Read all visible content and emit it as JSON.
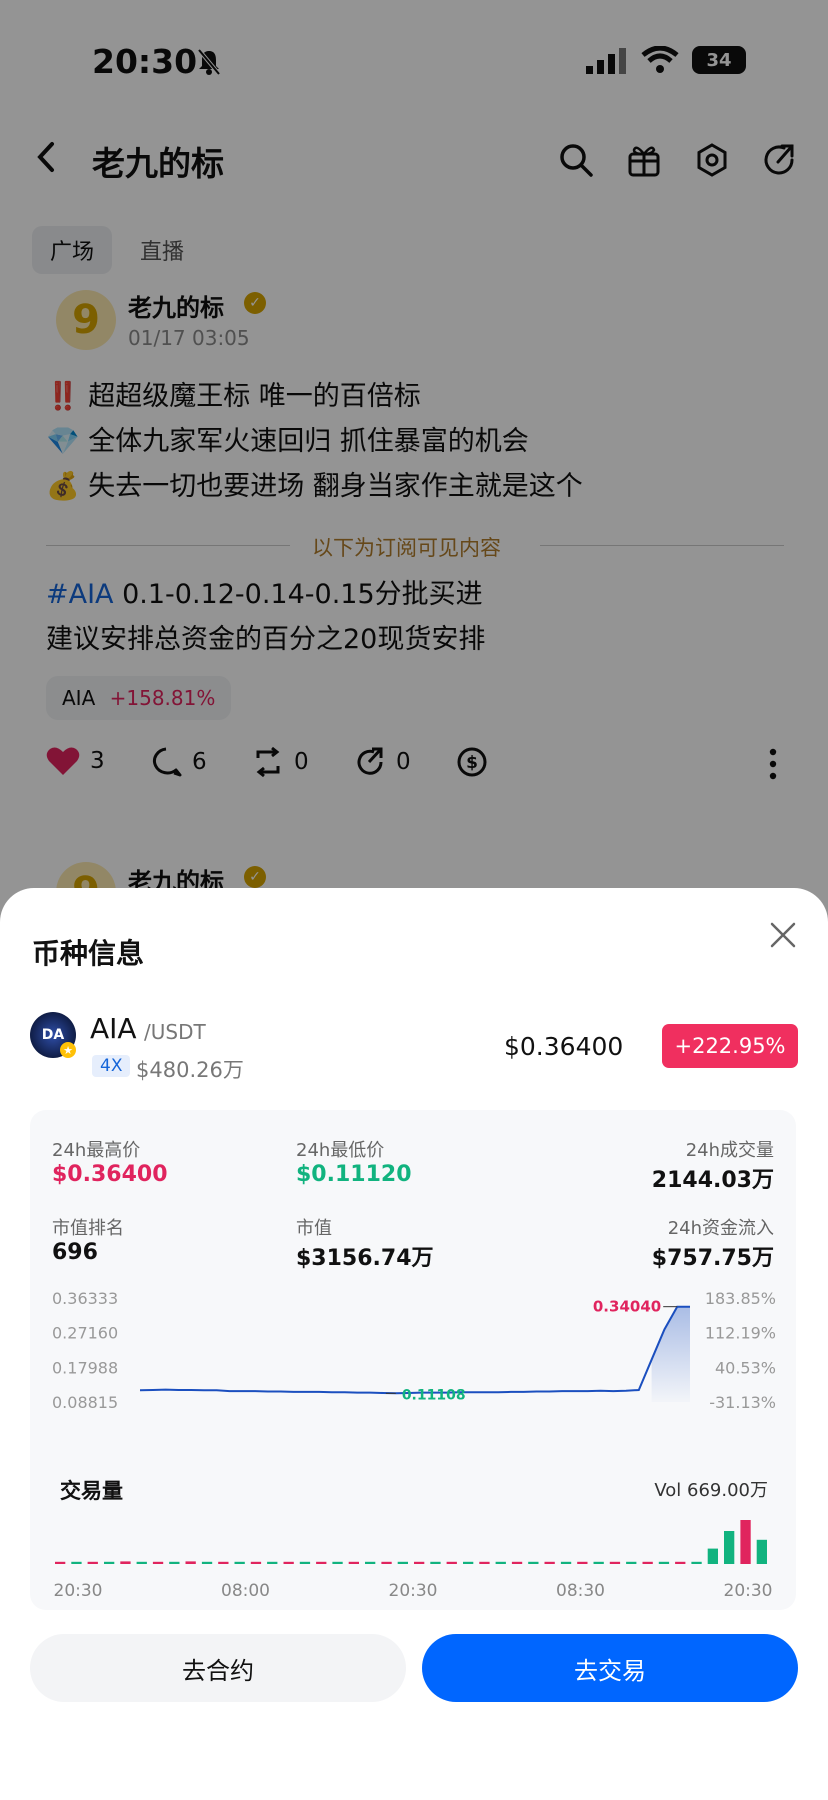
{
  "status_bar": {
    "time": "20:30",
    "battery": "34"
  },
  "header": {
    "title": "老九的标"
  },
  "tabs": [
    {
      "label": "广场"
    },
    {
      "label": "直播"
    }
  ],
  "post": {
    "author": "老九的标",
    "avatar_text": "9",
    "date": "01/17 03:05",
    "lines": [
      {
        "emoji": "‼️",
        "text": "超超级魔王标 唯一的百倍标"
      },
      {
        "emoji": "💎",
        "text": "全体九家军火速回归 抓住暴富的机会"
      },
      {
        "emoji": "💰",
        "text": "失去一切也要进场 翻身当家作主就是这个"
      }
    ],
    "divider_text": "以下为订阅可见内容",
    "hashtag": "#AIA",
    "body1": " 0.1-0.12-0.14-0.15分批买进",
    "body2": "建议安排总资金的百分之20现货安排",
    "token_pill": {
      "symbol": "AIA",
      "change": "+158.81%"
    },
    "actions": {
      "likes": "3",
      "comments": "6",
      "reposts": "0",
      "shares": "0"
    }
  },
  "post2": {
    "author": "老九的标"
  },
  "sheet": {
    "title": "币种信息",
    "coin": {
      "avatar_text": "DA",
      "symbol": "AIA",
      "pair": "/USDT",
      "leverage": "4X",
      "market_cap_small": "$480.26万",
      "price": "$0.36400",
      "change": "+222.95%"
    },
    "stats": [
      {
        "label": "24h最高价",
        "value": "$0.36400",
        "color": "#e0245e"
      },
      {
        "label": "24h最低价",
        "value": "$0.11120",
        "color": "#11b37f"
      },
      {
        "label": "24h成交量",
        "value": "2144.03万",
        "color": "#111111"
      },
      {
        "label": "市值排名",
        "value": "696",
        "color": "#111111"
      },
      {
        "label": "市值",
        "value": "$3156.74万",
        "color": "#111111"
      },
      {
        "label": "24h资金流入",
        "value": "$757.75万",
        "color": "#111111"
      }
    ],
    "volume_label": "交易量",
    "vol_text": "Vol 669.00万",
    "buttons": {
      "contract": "去合约",
      "trade": "去交易"
    }
  },
  "chart_data": {
    "type": "line",
    "y_left_ticks": [
      "0.36333",
      "0.27160",
      "0.17988",
      "0.08815"
    ],
    "y_right_ticks": [
      "183.85%",
      "112.19%",
      "40.53%",
      "-31.13%"
    ],
    "x_ticks": [
      "20:30",
      "08:00",
      "20:30",
      "08:30",
      "20:30"
    ],
    "ylim": [
      0.08815,
      0.36333
    ],
    "annotations": {
      "high": "0.34040",
      "low": "0.11108"
    },
    "series": [
      {
        "values": [
          0.119,
          0.12,
          0.121,
          0.12,
          0.12,
          0.119,
          0.119,
          0.117,
          0.117,
          0.117,
          0.116,
          0.116,
          0.115,
          0.115,
          0.115,
          0.114,
          0.114,
          0.113,
          0.113,
          0.112,
          0.1111,
          0.112,
          0.113,
          0.113,
          0.113,
          0.114,
          0.114,
          0.114,
          0.114,
          0.115,
          0.115,
          0.116,
          0.116,
          0.117,
          0.117,
          0.117,
          0.118,
          0.117,
          0.118,
          0.12,
          0.2,
          0.28,
          0.3404,
          0.3404
        ]
      }
    ],
    "volume": {
      "bars": [
        {
          "v": 0.05,
          "c": "#e0245e"
        },
        {
          "v": 0.05,
          "c": "#11b37f"
        },
        {
          "v": 0.05,
          "c": "#e0245e"
        },
        {
          "v": 0.05,
          "c": "#11b37f"
        },
        {
          "v": 0.06,
          "c": "#e0245e"
        },
        {
          "v": 0.05,
          "c": "#11b37f"
        },
        {
          "v": 0.05,
          "c": "#e0245e"
        },
        {
          "v": 0.05,
          "c": "#11b37f"
        },
        {
          "v": 0.06,
          "c": "#e0245e"
        },
        {
          "v": 0.05,
          "c": "#11b37f"
        },
        {
          "v": 0.05,
          "c": "#e0245e"
        },
        {
          "v": 0.05,
          "c": "#11b37f"
        },
        {
          "v": 0.05,
          "c": "#e0245e"
        },
        {
          "v": 0.05,
          "c": "#11b37f"
        },
        {
          "v": 0.05,
          "c": "#e0245e"
        },
        {
          "v": 0.05,
          "c": "#11b37f"
        },
        {
          "v": 0.05,
          "c": "#e0245e"
        },
        {
          "v": 0.05,
          "c": "#11b37f"
        },
        {
          "v": 0.05,
          "c": "#e0245e"
        },
        {
          "v": 0.05,
          "c": "#11b37f"
        },
        {
          "v": 0.05,
          "c": "#e0245e"
        },
        {
          "v": 0.05,
          "c": "#11b37f"
        },
        {
          "v": 0.05,
          "c": "#e0245e"
        },
        {
          "v": 0.05,
          "c": "#11b37f"
        },
        {
          "v": 0.05,
          "c": "#e0245e"
        },
        {
          "v": 0.05,
          "c": "#11b37f"
        },
        {
          "v": 0.05,
          "c": "#e0245e"
        },
        {
          "v": 0.05,
          "c": "#11b37f"
        },
        {
          "v": 0.05,
          "c": "#e0245e"
        },
        {
          "v": 0.05,
          "c": "#11b37f"
        },
        {
          "v": 0.05,
          "c": "#e0245e"
        },
        {
          "v": 0.05,
          "c": "#11b37f"
        },
        {
          "v": 0.05,
          "c": "#e0245e"
        },
        {
          "v": 0.05,
          "c": "#11b37f"
        },
        {
          "v": 0.05,
          "c": "#e0245e"
        },
        {
          "v": 0.05,
          "c": "#11b37f"
        },
        {
          "v": 0.05,
          "c": "#e0245e"
        },
        {
          "v": 0.05,
          "c": "#11b37f"
        },
        {
          "v": 0.05,
          "c": "#e0245e"
        },
        {
          "v": 0.05,
          "c": "#11b37f"
        },
        {
          "v": 0.35,
          "c": "#11b37f"
        },
        {
          "v": 0.75,
          "c": "#11b37f"
        },
        {
          "v": 1.0,
          "c": "#e0245e"
        },
        {
          "v": 0.55,
          "c": "#11b37f"
        }
      ]
    }
  },
  "colors": {
    "accent_blue": "#0066ff",
    "up_red": "#e0245e",
    "down_green": "#11b37f",
    "line_blue": "#1b4fbf",
    "gold": "#d6a400"
  }
}
